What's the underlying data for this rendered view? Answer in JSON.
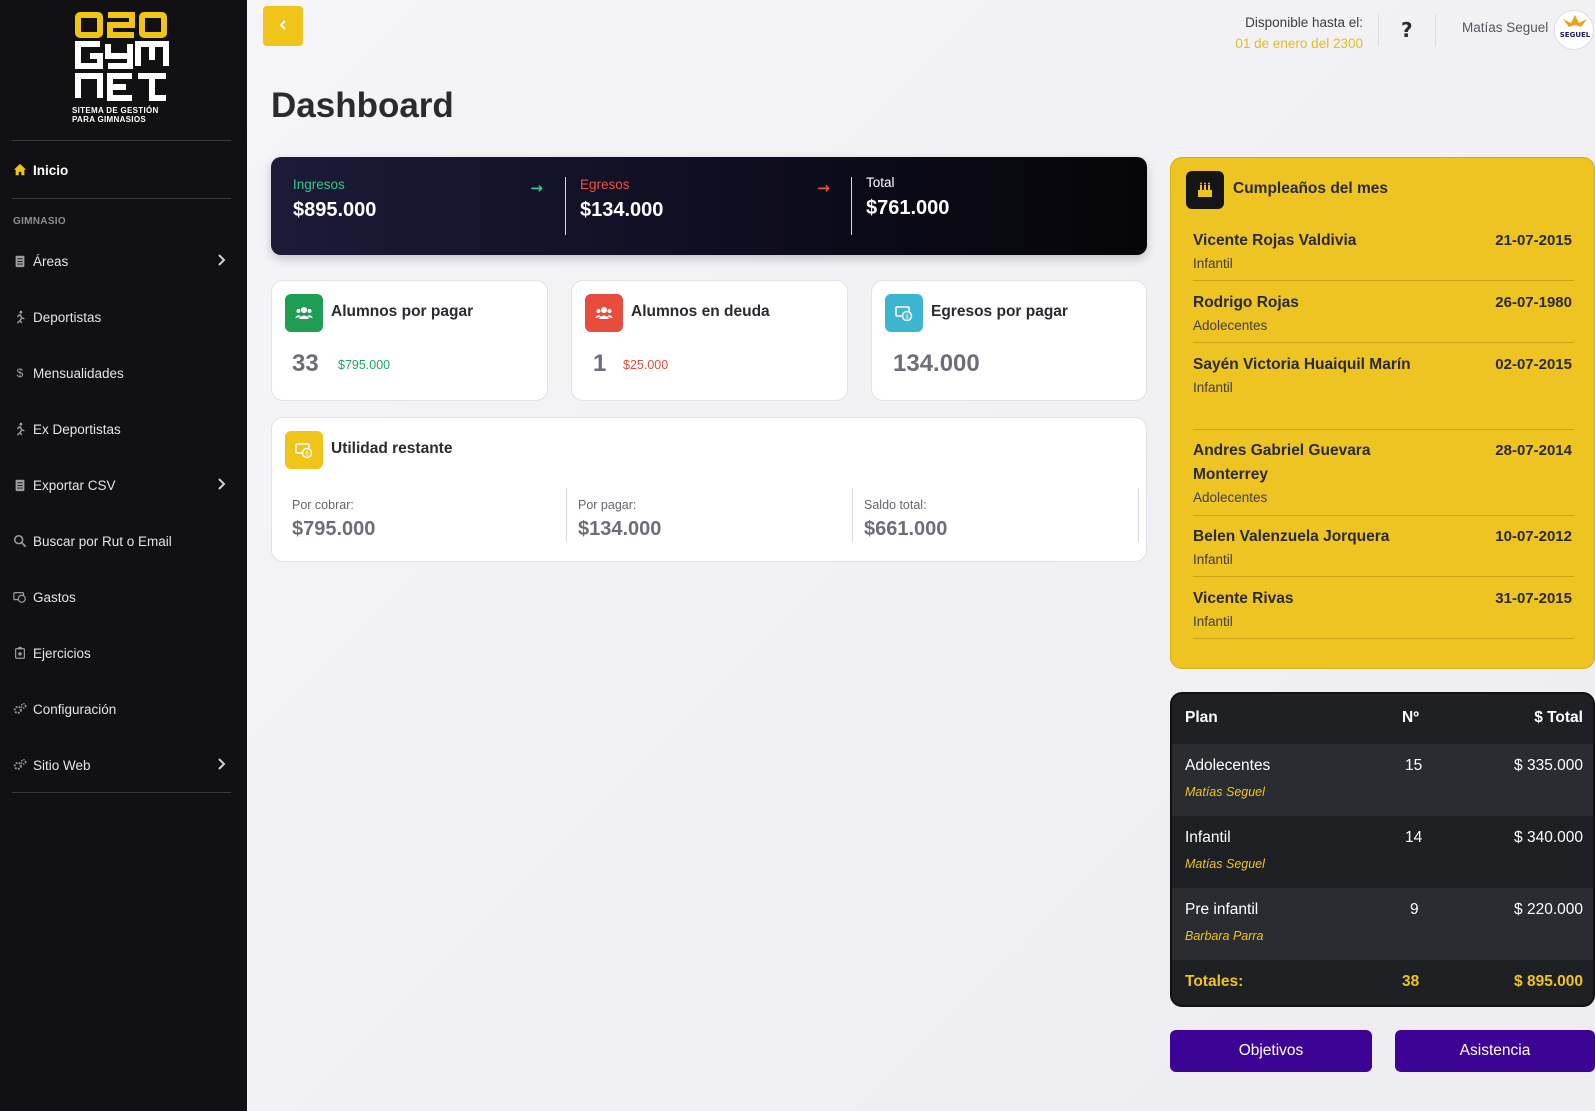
{
  "brand": {
    "logo_text": "020 GYM NET",
    "subtitle_line1": "SITEMA DE GESTIÓN",
    "subtitle_line2": "PARA  GIMNASIOS",
    "accent": "#f0c419"
  },
  "sidebar": {
    "active_item": {
      "label": "Inicio",
      "icon": "home-icon"
    },
    "section_label": "GIMNASIO",
    "items": [
      {
        "label": "Áreas",
        "icon": "clipboard-icon",
        "has_submenu": true
      },
      {
        "label": "Deportistas",
        "icon": "running-icon",
        "has_submenu": false
      },
      {
        "label": "Mensualidades",
        "icon": "dollar-icon",
        "has_submenu": false
      },
      {
        "label": "Ex Deportistas",
        "icon": "running-icon",
        "has_submenu": false
      },
      {
        "label": "Exportar CSV",
        "icon": "clipboard-icon",
        "has_submenu": true
      },
      {
        "label": "Buscar por Rut o Email",
        "icon": "search-icon",
        "has_submenu": false
      },
      {
        "label": "Gastos",
        "icon": "money-icon",
        "has_submenu": false
      },
      {
        "label": "Ejercicios",
        "icon": "dumbbell-icon",
        "has_submenu": false
      },
      {
        "label": "Configuración",
        "icon": "cogs-icon",
        "has_submenu": false
      },
      {
        "label": "Sitio Web",
        "icon": "cogs-icon",
        "has_submenu": true
      }
    ]
  },
  "header": {
    "back_icon": "chevron-left-icon",
    "availability_label": "Disponible hasta el:",
    "availability_date": "01 de enero del 2300",
    "help_label": "?",
    "user_name": "Matías Seguel",
    "avatar_text": "SEGUEL"
  },
  "page": {
    "title": "Dashboard"
  },
  "summary": {
    "income": {
      "label": "Ingresos",
      "value": "$895.000",
      "color": "#2ecc8a"
    },
    "expenses": {
      "label": "Egresos",
      "value": "$134.000",
      "color": "#f0533c"
    },
    "total": {
      "label": "Total",
      "value": "$761.000"
    }
  },
  "cards": {
    "students_to_pay": {
      "title": "Alumnos por pagar",
      "count": "33",
      "amount": "$795.000",
      "color": "#1f9d55"
    },
    "students_in_debt": {
      "title": "Alumnos en deuda",
      "count": "1",
      "amount": "$25.000",
      "color": "#e74c3c"
    },
    "expenses_to_pay": {
      "title": "Egresos por pagar",
      "amount": "134.000",
      "color": "#3db4d0"
    }
  },
  "utility": {
    "title": "Utilidad restante",
    "color": "#f0c419",
    "receivable": {
      "label": "Por cobrar:",
      "value": "$795.000"
    },
    "payable": {
      "label": "Por pagar:",
      "value": "$134.000"
    },
    "balance": {
      "label": "Saldo total:",
      "value": "$661.000"
    }
  },
  "birthdays": {
    "title": "Cumpleaños del mes",
    "rows": [
      {
        "name": "Vicente Rojas Valdivia",
        "category": "Infantil",
        "date": "21-07-2015"
      },
      {
        "name": "Rodrigo Rojas",
        "category": "Adolecentes",
        "date": "26-07-1980"
      },
      {
        "name": "Sayén Victoria Huaiquil Marín",
        "category": "Infantil",
        "date": "02-07-2015"
      },
      {
        "name": "Andres Gabriel Guevara Monterrey",
        "category": "Adolecentes",
        "date": "28-07-2014"
      },
      {
        "name": "Belen Valenzuela Jorquera",
        "category": "Infantil",
        "date": "10-07-2012"
      },
      {
        "name": "Vicente Rivas",
        "category": "Infantil",
        "date": "31-07-2015"
      }
    ]
  },
  "plan_table": {
    "headers": {
      "plan": "Plan",
      "count": "Nº",
      "total": "$ Total"
    },
    "rows": [
      {
        "plan": "Adolecentes",
        "coach": "Matías Seguel",
        "count": "15",
        "total": "$ 335.000"
      },
      {
        "plan": "Infantil",
        "coach": "Matías Seguel",
        "count": "14",
        "total": "$ 340.000"
      },
      {
        "plan": "Pre infantil",
        "coach": "Barbara Parra",
        "count": "9",
        "total": "$ 220.000"
      }
    ],
    "totals": {
      "label": "Totales:",
      "count": "38",
      "total": "$ 895.000"
    }
  },
  "actions": {
    "objectives": "Objetivos",
    "attendance": "Asistencia",
    "color": "#3c0396"
  }
}
